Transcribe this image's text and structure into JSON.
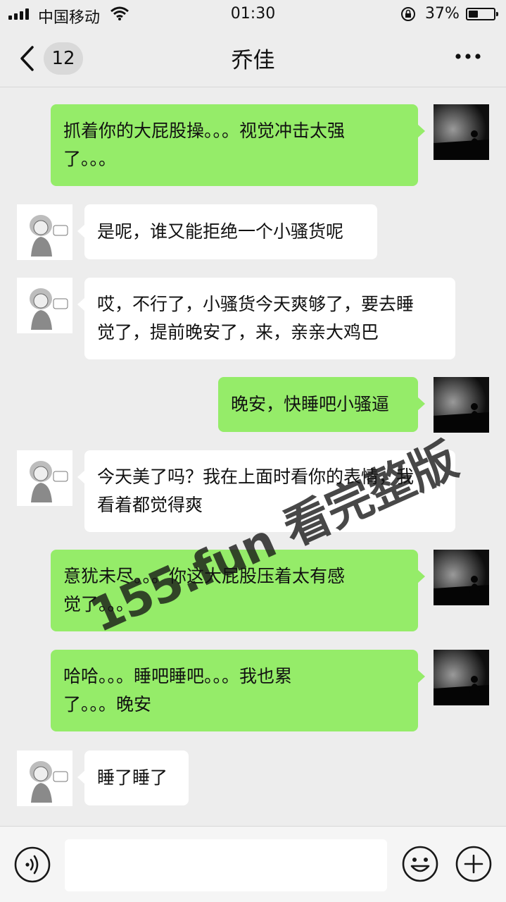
{
  "status_bar": {
    "carrier": "中国移动",
    "time": "01:30",
    "battery_pct": "37%",
    "battery_level": 0.37
  },
  "nav": {
    "back_icon": "chevron-left-icon",
    "unread_count": "12",
    "title": "乔佳",
    "more_icon": "more-dots-icon"
  },
  "messages": [
    {
      "side": "right",
      "lines": [
        "抓着你的大屁股操。。。视觉冲击太强",
        "了。。。"
      ]
    },
    {
      "side": "left",
      "lines": [
        "是呢，谁又能拒绝一个小骚货呢"
      ]
    },
    {
      "side": "left",
      "lines": [
        "哎，不行了，小骚货今天爽够了，要去睡",
        "觉了，提前晚安了，来，亲亲大鸡巴"
      ]
    },
    {
      "side": "right",
      "lines": [
        "晚安，快睡吧小骚逼"
      ]
    },
    {
      "side": "left",
      "lines": [
        "今天美了吗？我在上面时看你的表情，我",
        "看着都觉得爽"
      ]
    },
    {
      "side": "right",
      "lines": [
        "意犹未尽。。。你这大屁股压着太有感",
        "觉了。。。"
      ]
    },
    {
      "side": "right",
      "lines": [
        "哈哈。。。睡吧睡吧。。。我也累",
        "了。。。晚安"
      ]
    },
    {
      "side": "left",
      "lines": [
        "睡了睡了"
      ]
    }
  ],
  "watermark": "155.fun 看完整版",
  "input_bar": {
    "voice_icon": "voice-icon",
    "emoji_icon": "emoji-icon",
    "plus_icon": "plus-icon",
    "value": ""
  },
  "colors": {
    "background": "#ededed",
    "sent_bubble": "#95ec69",
    "received_bubble": "#ffffff"
  }
}
